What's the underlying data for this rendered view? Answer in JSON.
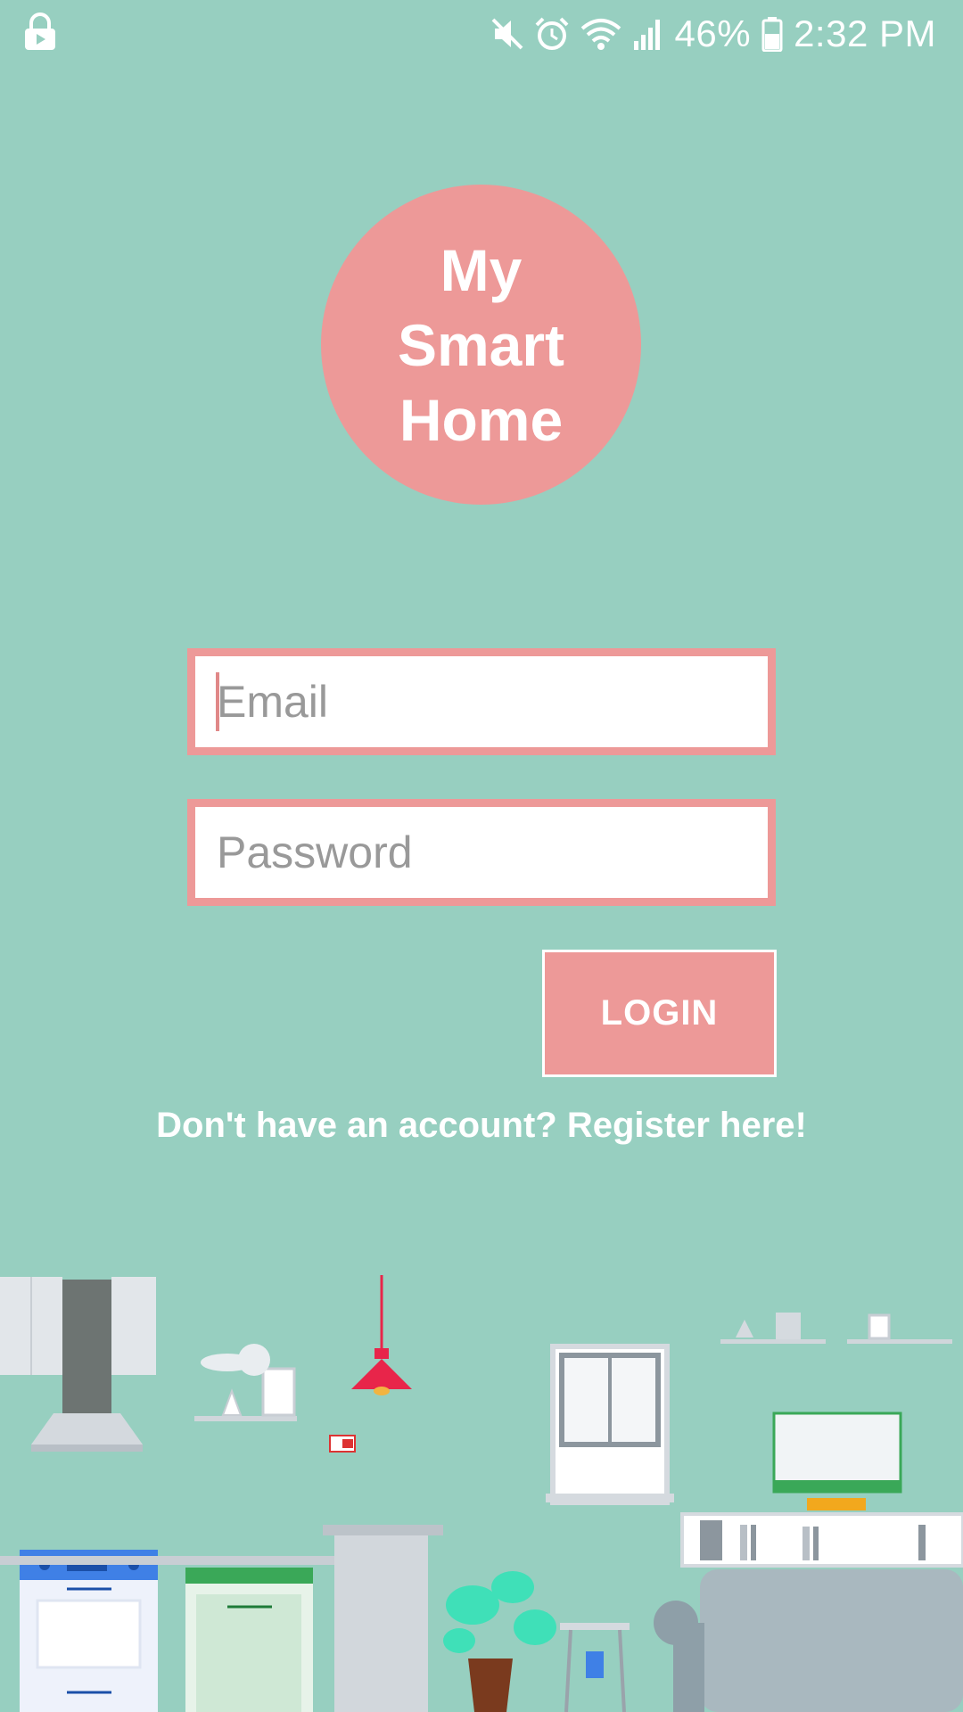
{
  "status_bar": {
    "battery": "46%",
    "time": "2:32 PM",
    "icons": [
      "lock-icon",
      "mute-icon",
      "alarm-icon",
      "wifi-icon",
      "signal-icon",
      "battery-icon"
    ]
  },
  "logo": {
    "line1": "My",
    "line2": "Smart",
    "line3": "Home"
  },
  "form": {
    "email_placeholder": "Email",
    "password_placeholder": "Password",
    "login_label": "LOGIN",
    "register_text": "Don't have an account? Register here!"
  },
  "colors": {
    "background": "#97cfc0",
    "accent": "#ed9998",
    "text_light": "#ffffff"
  }
}
